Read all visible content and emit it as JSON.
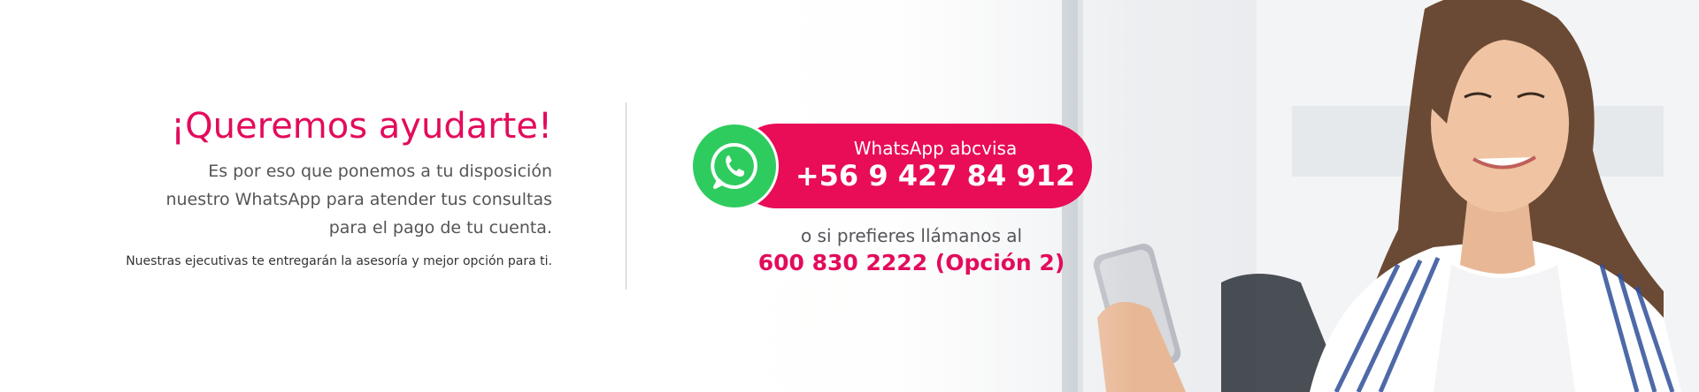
{
  "headline": "¡Queremos ayudarte!",
  "intro_lines": [
    "Es por eso que ponemos a tu disposición",
    "nuestro WhatsApp para atender tus consultas",
    "para el pago de tu cuenta."
  ],
  "note": "Nuestras ejecutivas te entregarán la asesoría y mejor opción para ti.",
  "whatsapp": {
    "label": "WhatsApp abcvisa",
    "number": "+56 9 427 84 912",
    "icon": "whatsapp-icon"
  },
  "call": {
    "text": "o si prefieres llámanos al",
    "number": "600 830 2222 (Opción 2)"
  },
  "colors": {
    "brand_pink": "#e90c57",
    "whatsapp_green": "#2ecc5f",
    "body_gray": "#555558"
  }
}
